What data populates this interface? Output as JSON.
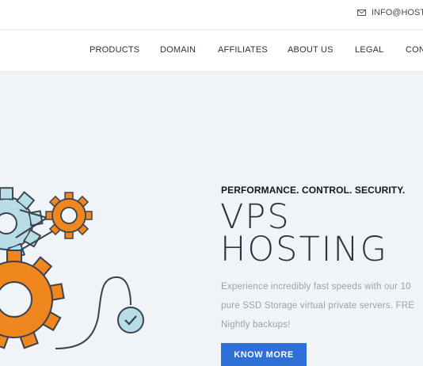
{
  "topbar": {
    "email": "INFO@HOSTE"
  },
  "nav": {
    "items": [
      "PRODUCTS",
      "DOMAIN",
      "AFFILIATES",
      "ABOUT US",
      "LEGAL",
      "CON"
    ]
  },
  "hero": {
    "tagline": "PERFORMANCE. CONTROL. SECURITY.",
    "title_line1": "VPS",
    "title_line2": "HOSTING",
    "description_lines": [
      "Experience incredibly fast speeds with our 10",
      "pure SSD Storage virtual private servers. FRE",
      "Nightly backups!"
    ],
    "button_label": "KNOW MORE"
  },
  "colors": {
    "accent_button": "#2f6fd8",
    "gear_orange": "#f0861e",
    "gear_blue": "#b8dde4",
    "background": "#f1f4f7"
  },
  "icons": {
    "email": "envelope-icon",
    "illustration": "gears-illustration",
    "check": "check-circle-icon"
  }
}
